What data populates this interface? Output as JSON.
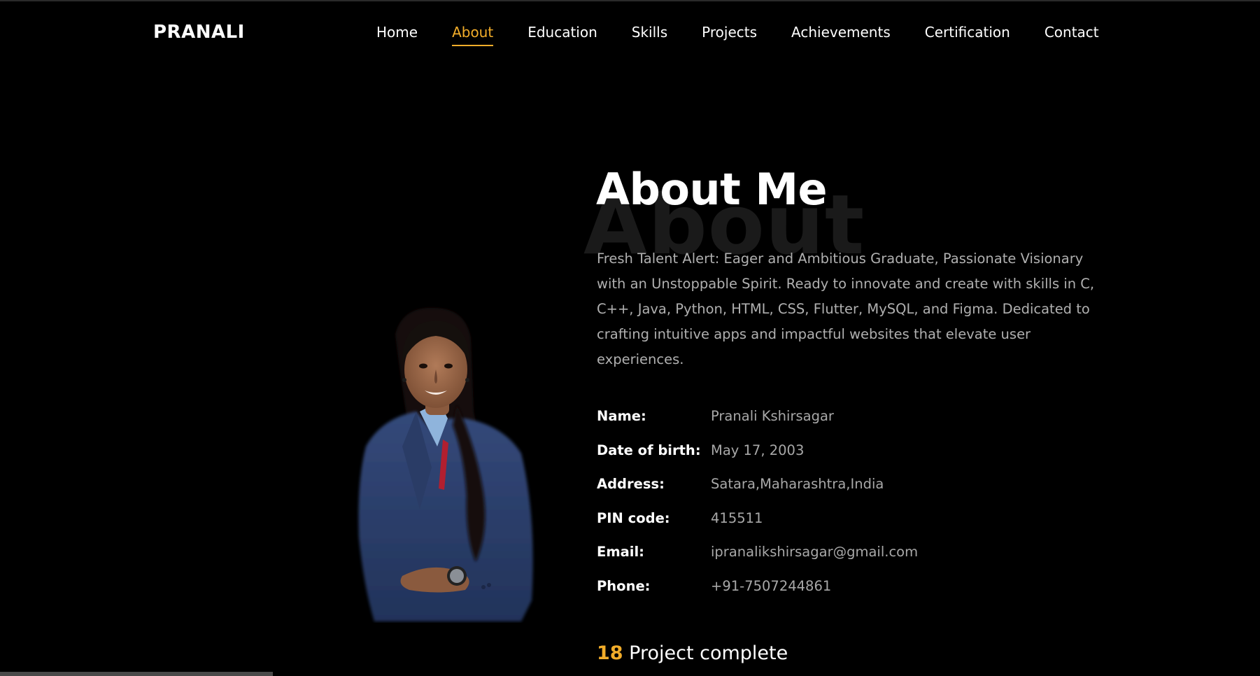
{
  "brand": "PRANALI",
  "nav": {
    "items": [
      {
        "label": "Home"
      },
      {
        "label": "About"
      },
      {
        "label": "Education"
      },
      {
        "label": "Skills"
      },
      {
        "label": "Projects"
      },
      {
        "label": "Achievements"
      },
      {
        "label": "Certification"
      },
      {
        "label": "Contact"
      }
    ],
    "active": "About"
  },
  "about": {
    "watermark": "About",
    "title": "About Me",
    "description": "Fresh Talent Alert: Eager and Ambitious Graduate, Passionate Visionary with an Unstoppable Spirit. Ready to innovate and create with skills in C, C++, Java, Python, HTML, CSS, Flutter, MySQL, and Figma. Dedicated to crafting intuitive apps and impactful websites that elevate user experiences.",
    "info": [
      {
        "label": "Name:",
        "value": "Pranali Kshirsagar"
      },
      {
        "label": "Date of birth:",
        "value": "May 17, 2003"
      },
      {
        "label": "Address:",
        "value": "Satara,Maharashtra,India"
      },
      {
        "label": "PIN code:",
        "value": "415511"
      },
      {
        "label": "Email:",
        "value": "ipranalikshirsagar@gmail.com"
      },
      {
        "label": "Phone:",
        "value": "+91-7507244861"
      }
    ],
    "counter": {
      "number": "18",
      "label": "Project complete"
    }
  },
  "colors": {
    "accent": "#f2ad2a",
    "background": "#000000",
    "text": "#ffffff",
    "muted": "#b0b0b0",
    "blazer": "#2c3f66"
  },
  "icons": {
    "profile_photo": "person-portrait"
  }
}
